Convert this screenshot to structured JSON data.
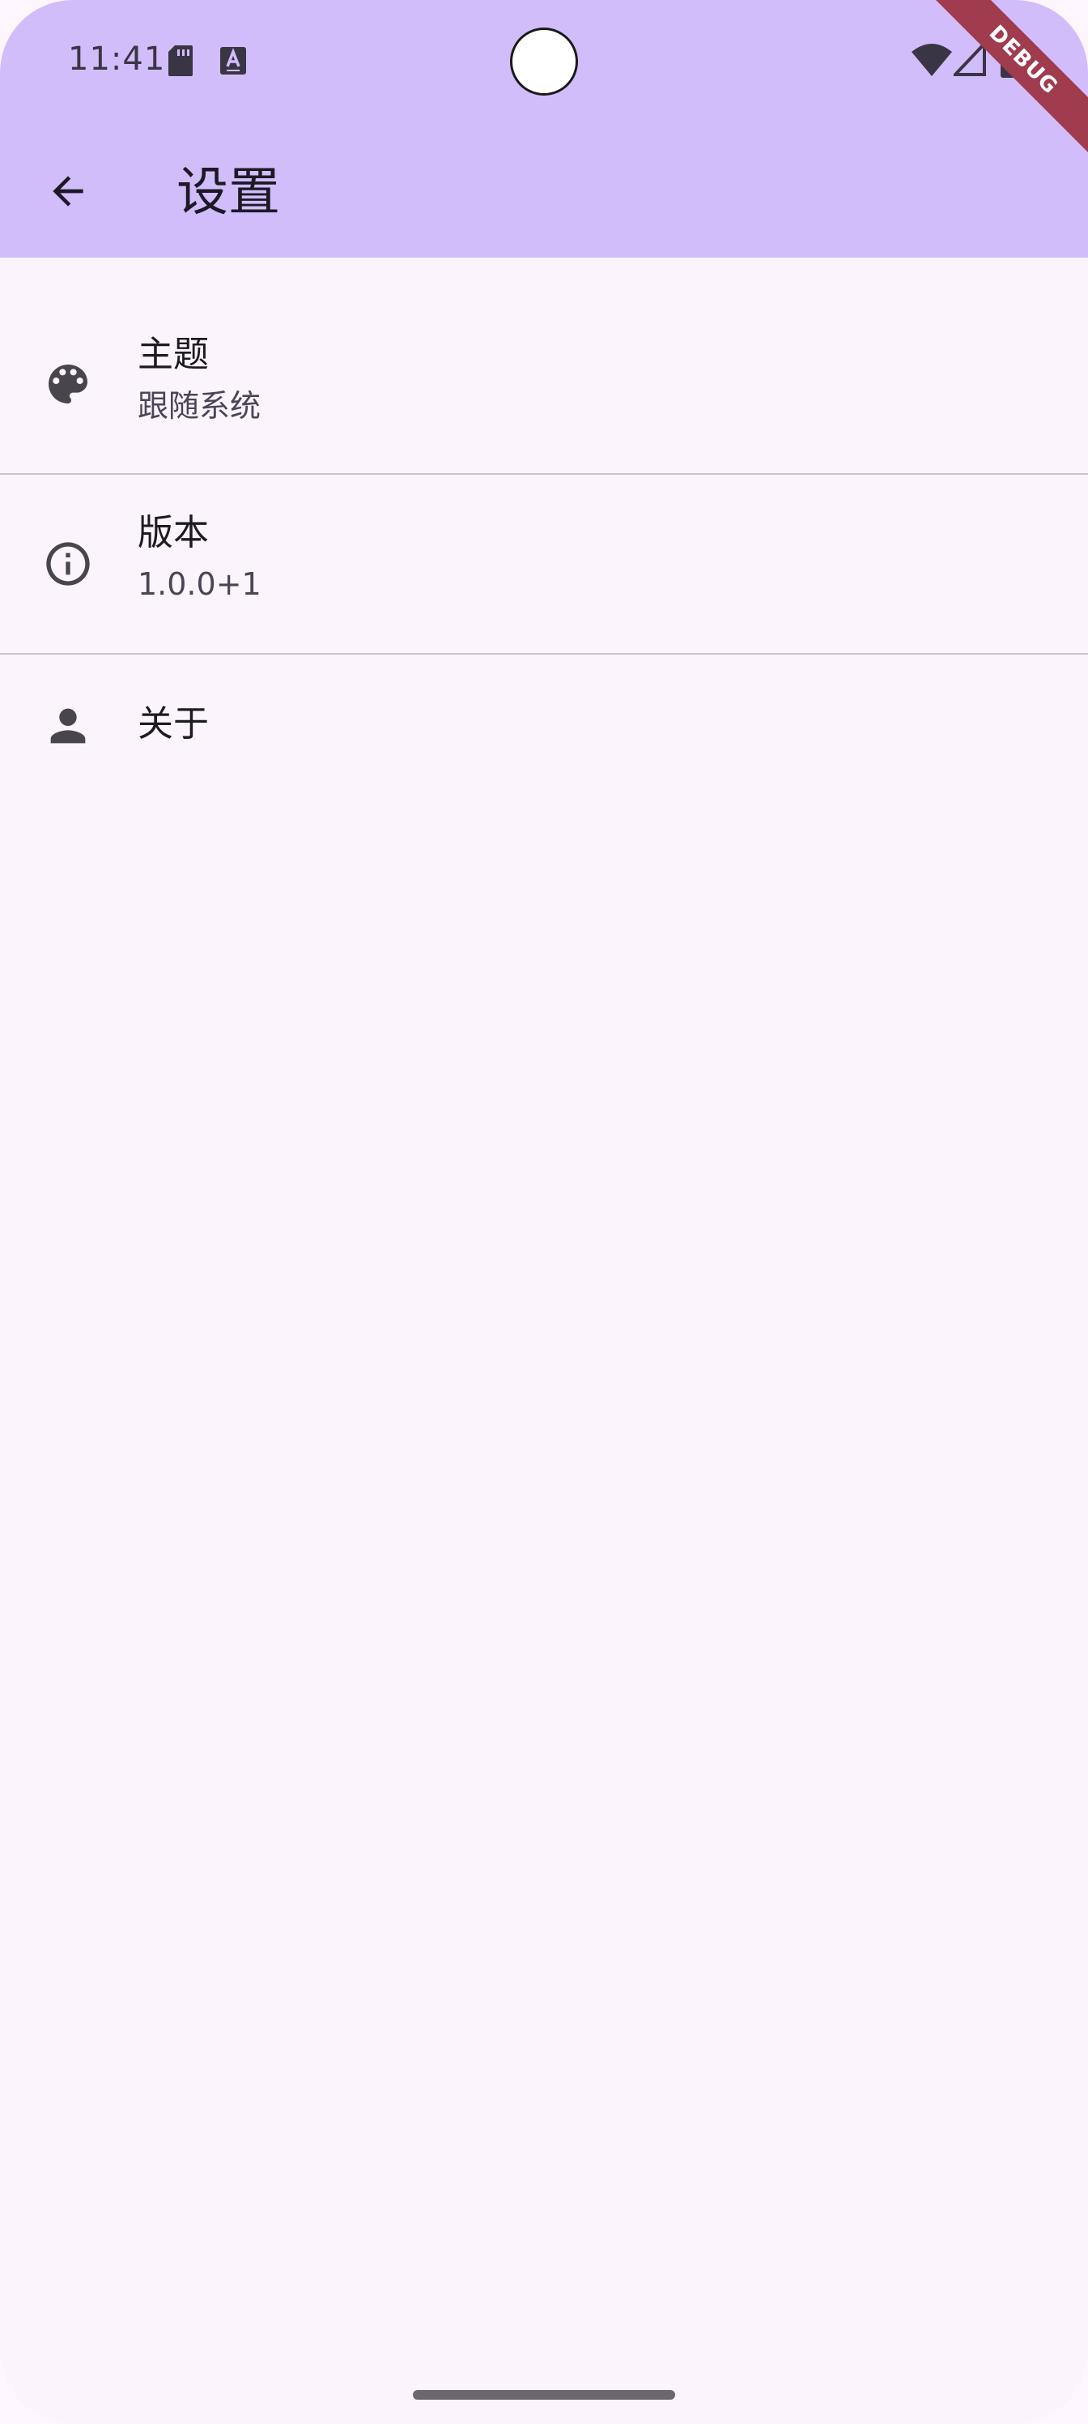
{
  "status_bar": {
    "time": "11:41",
    "left_icons": [
      "sd-card-icon",
      "font-a-icon"
    ],
    "right_icons": [
      "wifi-icon",
      "cell-signal-icon",
      "battery-icon"
    ],
    "debug_label": "DEBUG"
  },
  "app_bar": {
    "back_icon": "arrow-back-icon",
    "title": "设置"
  },
  "settings": {
    "theme": {
      "icon": "palette-icon",
      "title": "主题",
      "subtitle": "跟随系统"
    },
    "version": {
      "icon": "info-icon",
      "title": "版本",
      "subtitle": "1.0.0+1"
    },
    "about": {
      "icon": "person-icon",
      "title": "关于"
    }
  },
  "colors": {
    "app_bar": "#d2bdfb",
    "background": "#fcf4fd",
    "debug_ribbon": "#a13b4e"
  }
}
